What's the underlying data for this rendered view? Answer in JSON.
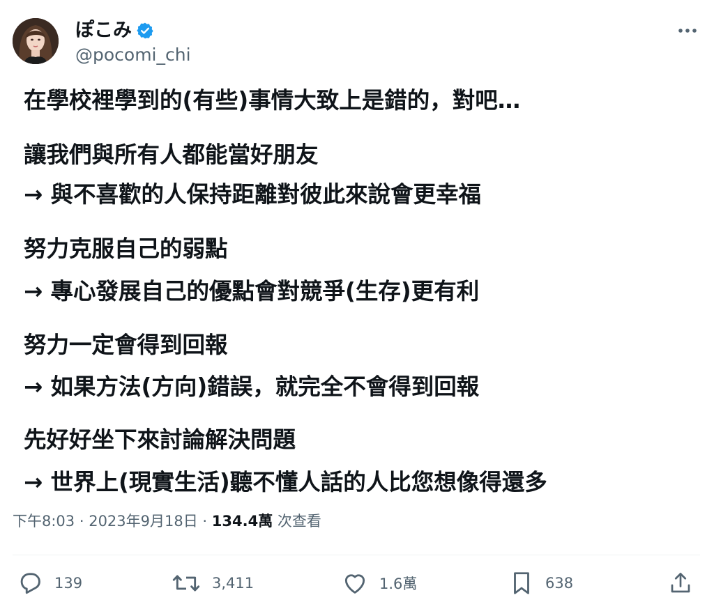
{
  "author": {
    "display_name": "ぽこみ",
    "handle": "@pocomi_chi",
    "verified": true
  },
  "tweet": {
    "lines": [
      "在學校裡學到的(有些)事情大致上是錯的，對吧…",
      "讓我們與所有人都能當好朋友",
      "→ 與不喜歡的人保持距離對彼此來說會更幸福",
      "努力克服自己的弱點",
      "→ 專心發展自己的優點會對競爭(生存)更有利",
      "努力一定會得到回報",
      "→ 如果方法(方向)錯誤，就完全不會得到回報",
      "先好好坐下來討論解決問題",
      "→ 世界上(現實生活)聽不懂人話的人比您想像得還多"
    ]
  },
  "meta": {
    "time": "下午8:03",
    "date": "2023年9月18日",
    "sep1": " · ",
    "sep2": " · ",
    "views": "134.4萬",
    "views_label": " 次查看"
  },
  "actions": {
    "replies": "139",
    "reposts": "3,411",
    "likes": "1.6萬",
    "bookmarks": "638"
  },
  "icons": {
    "verified": "verified-badge-icon",
    "more": "more-dots-icon",
    "reply": "reply-icon",
    "repost": "repost-icon",
    "like": "heart-icon",
    "bookmark": "bookmark-icon",
    "share": "share-icon"
  },
  "colors": {
    "verified_blue": "#1d9bf0",
    "text_primary": "#0f1419",
    "text_secondary": "#536471"
  }
}
